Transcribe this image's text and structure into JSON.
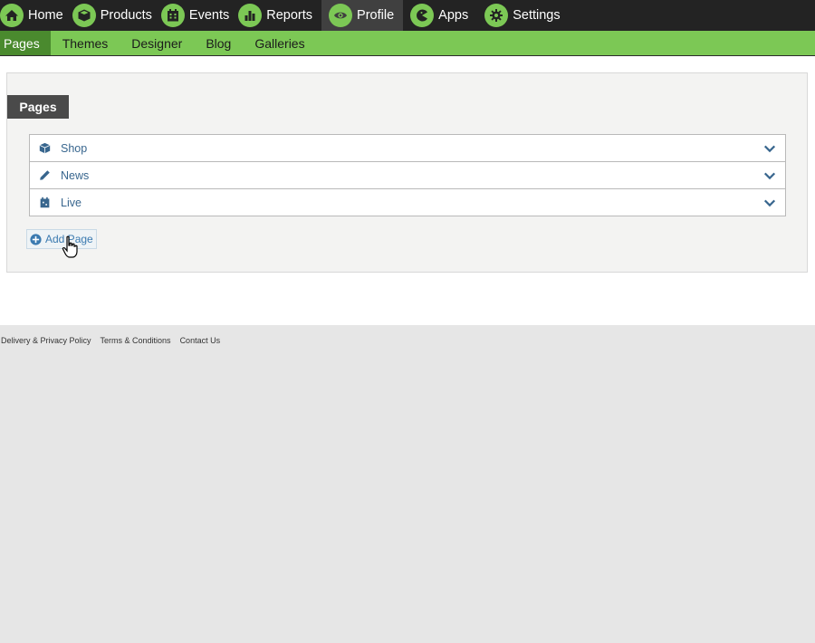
{
  "topnav": {
    "items": [
      {
        "label": "Home",
        "icon": "home-icon"
      },
      {
        "label": "Products",
        "icon": "box-icon"
      },
      {
        "label": "Events",
        "icon": "calendar-icon"
      },
      {
        "label": "Reports",
        "icon": "bar-chart-icon"
      },
      {
        "label": "Profile",
        "icon": "eye-icon",
        "active": true
      },
      {
        "label": "Apps",
        "icon": "pacman-icon"
      },
      {
        "label": "Settings",
        "icon": "gear-icon"
      }
    ]
  },
  "subnav": {
    "items": [
      {
        "label": "Pages",
        "active": true
      },
      {
        "label": "Themes"
      },
      {
        "label": "Designer"
      },
      {
        "label": "Blog"
      },
      {
        "label": "Galleries"
      }
    ]
  },
  "panel": {
    "heading": "Pages",
    "rows": [
      {
        "label": "Shop",
        "icon": "box-icon"
      },
      {
        "label": "News",
        "icon": "pencil-icon"
      },
      {
        "label": "Live",
        "icon": "calendar-icon"
      }
    ],
    "add_label": "Add Page"
  },
  "footer": {
    "links": [
      "Delivery & Privacy Policy",
      "Terms & Conditions",
      "Contact Us"
    ]
  },
  "colors": {
    "topnav_bg": "#232323",
    "accent_green": "#7cc855",
    "active_subnav": "#4a8a2e",
    "row_text": "#38668e",
    "link_blue": "#3b7ab0"
  }
}
